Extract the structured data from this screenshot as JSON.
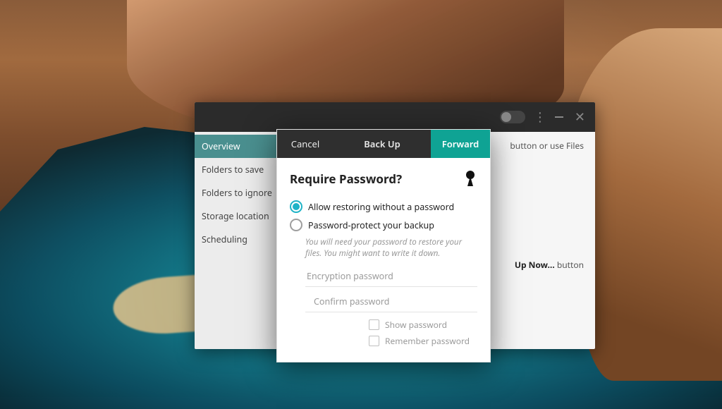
{
  "colors": {
    "accent": "#0fa394",
    "sidebar_active": "#4a8f8f",
    "radio_active": "#1fb3c7"
  },
  "app": {
    "titlebar": {
      "toggle_state": "off",
      "menu_icon": "more-vert",
      "minimize_icon": "minimize",
      "close_icon": "close"
    },
    "sidebar": {
      "items": [
        {
          "label": "Overview",
          "active": true
        },
        {
          "label": "Folders to save",
          "active": false
        },
        {
          "label": "Folders to ignore",
          "active": false
        },
        {
          "label": "Storage location",
          "active": false
        },
        {
          "label": "Scheduling",
          "active": false
        }
      ]
    },
    "main": {
      "hint_top_suffix": "button or use Files",
      "hint_mid_prefix": "Up Now…",
      "hint_mid_suffix": " button"
    }
  },
  "modal": {
    "header": {
      "cancel": "Cancel",
      "title": "Back Up",
      "forward": "Forward"
    },
    "question": "Require Password?",
    "icon": "keyhole-icon",
    "radios": [
      {
        "label": "Allow restoring without a password",
        "checked": true
      },
      {
        "label": "Password-protect your backup",
        "checked": false
      }
    ],
    "password_hint": "You will need your password to restore your files. You might want to write it down.",
    "fields": {
      "encryption_placeholder": "Encryption password",
      "confirm_placeholder": "Confirm password"
    },
    "checkboxes": [
      {
        "label": "Show password",
        "checked": false
      },
      {
        "label": "Remember password",
        "checked": false
      }
    ]
  }
}
